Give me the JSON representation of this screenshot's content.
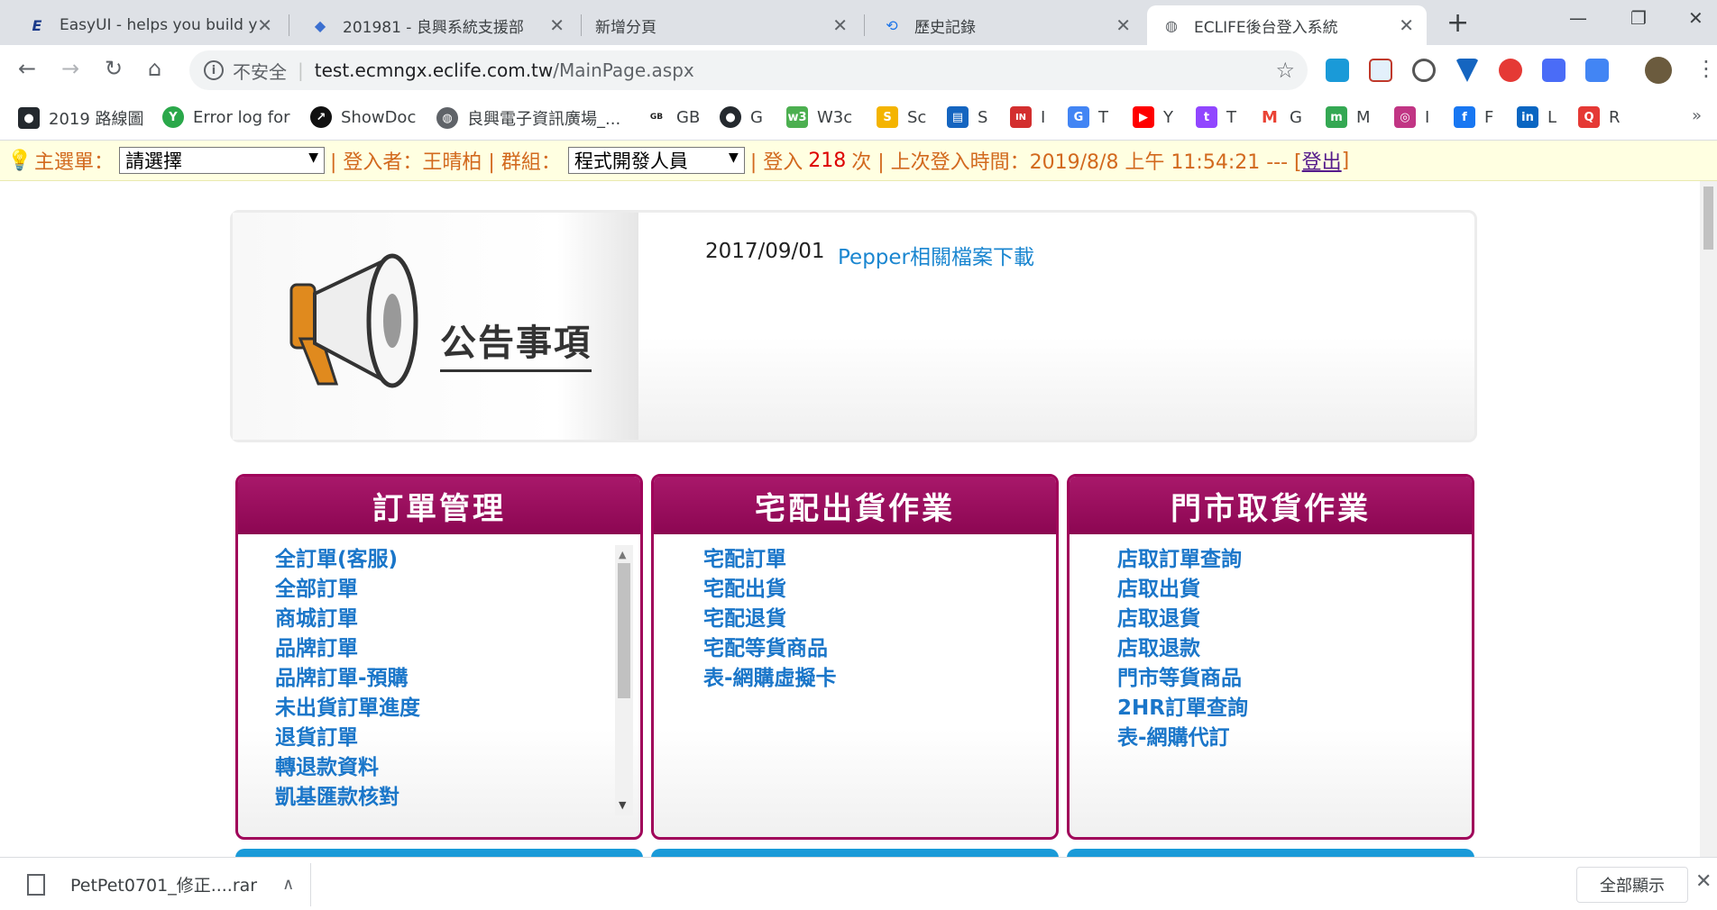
{
  "browser": {
    "tabs": [
      {
        "title": "EasyUI - helps you build y",
        "icon": "E"
      },
      {
        "title": "201981 - 良興系統支援部",
        "icon": "◆"
      },
      {
        "title": "新增分頁",
        "icon": ""
      },
      {
        "title": "歷史記錄",
        "icon": "⟲"
      },
      {
        "title": "ECLIFE後台登入系統",
        "icon": "◍"
      }
    ],
    "address": {
      "security": "不安全",
      "host": "test.ecmngx.eclife.com.tw",
      "path": "/MainPage.aspx"
    },
    "bookmarks": [
      {
        "label": "2019 路線圖",
        "color": "#24292e",
        "icon": "●"
      },
      {
        "label": "Error log for",
        "color": "#2aa84a",
        "icon": "Y"
      },
      {
        "label": "ShowDoc",
        "color": "#111",
        "icon": "↗"
      },
      {
        "label": "良興電子資訊廣場_...",
        "color": "#5f6368",
        "icon": "◍"
      },
      {
        "label": "GB",
        "color": "#222",
        "icon": "GB"
      },
      {
        "label": "G",
        "color": "#24292e",
        "icon": "●"
      },
      {
        "label": "W3c",
        "color": "#4caf50",
        "icon": "w3"
      },
      {
        "label": "Sc",
        "color": "#f4b400",
        "icon": "S"
      },
      {
        "label": "S",
        "color": "#1565c0",
        "icon": "▤"
      },
      {
        "label": "I",
        "color": "#d32f2f",
        "icon": "IN"
      },
      {
        "label": "T",
        "color": "#4285f4",
        "icon": "G"
      },
      {
        "label": "Y",
        "color": "#ff0000",
        "icon": "▶"
      },
      {
        "label": "T",
        "color": "#9146ff",
        "icon": "t"
      },
      {
        "label": "G",
        "color": "#ea4335",
        "icon": "M"
      },
      {
        "label": "M",
        "color": "#34a853",
        "icon": "m"
      },
      {
        "label": "I",
        "color": "#c13584",
        "icon": "◎"
      },
      {
        "label": "F",
        "color": "#1877f2",
        "icon": "f"
      },
      {
        "label": "L",
        "color": "#0a66c2",
        "icon": "in"
      },
      {
        "label": "R",
        "color": "#e53935",
        "icon": "Q"
      }
    ]
  },
  "infobar": {
    "menu_label": "主選單：",
    "menu_value": "請選擇",
    "user_text": "| 登入者：王晴柏 | 群組：",
    "group_value": "程式開發人員",
    "login_prefix": "| 登入",
    "login_count": "218",
    "login_suffix": "次 | 上次登入時間：2019/8/8 上午 11:54:21 --- [",
    "logout": "登出",
    "close_bracket": "]"
  },
  "notice": {
    "title": "公告事項",
    "date": "2017/09/01",
    "link": "Pepper相關檔案下載"
  },
  "panels": [
    {
      "title": "訂單管理",
      "items": [
        "全訂單(客服)",
        "全部訂單",
        "商城訂單",
        "品牌訂單",
        "品牌訂單-預購",
        "未出貨訂單進度",
        "退貨訂單",
        "轉退款資料",
        "凱基匯款核對"
      ]
    },
    {
      "title": "宅配出貨作業",
      "items": [
        "宅配訂單",
        "宅配出貨",
        "宅配退貨",
        "宅配等貨商品",
        "表-網購虛擬卡"
      ]
    },
    {
      "title": "門市取貨作業",
      "items": [
        "店取訂單查詢",
        "店取出貨",
        "店取退貨",
        "店取退款",
        "門市等貨商品",
        "2HR訂單查詢",
        "表-網購代訂"
      ]
    }
  ],
  "download": {
    "file": "PetPet0701_修正....rar",
    "show_all": "全部顯示"
  }
}
